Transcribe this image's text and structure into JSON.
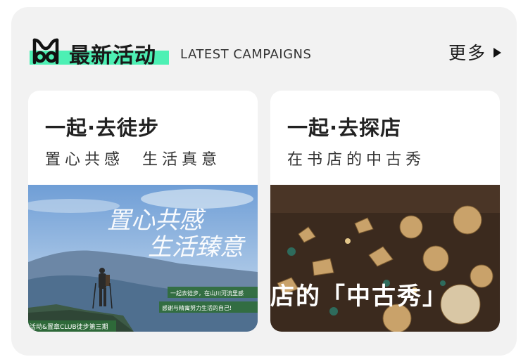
{
  "section": {
    "title": "最新活动",
    "subtitle": "LATEST CAMPAIGNS",
    "more_label": "更多"
  },
  "cards": [
    {
      "title": "一起·去徒步",
      "subtitle": "置心共感  生活真意",
      "image_text_main_1": "置心共感",
      "image_text_main_2": "生活臻意",
      "image_text_line_1": "一起去徒步，在山川河流里感",
      "image_text_line_2": "感谢与精寓努力生活的自己!",
      "image_text_footer": "活动&置章CLUB徒步第三期"
    },
    {
      "title": "一起·去探店",
      "subtitle": "在书店的中古秀",
      "image_text": "店的「中古秀」"
    }
  ],
  "colors": {
    "accent": "#4df0b4",
    "panel": "#f2f2f2"
  }
}
